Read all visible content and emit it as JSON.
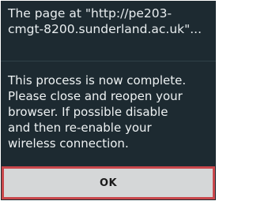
{
  "dialog": {
    "title": "The page at \"http://pe203-\ncmgt-8200.sunderland.ac.uk\"...",
    "message": "This process is now complete.\nPlease close and reopen your\nbrowser. If possible disable\nand then re-enable your\nwireless connection.",
    "ok_label": "OK"
  },
  "colors": {
    "dialog_background": "#1d2a31",
    "button_background": "#d5d7d8",
    "button_focus_border": "#c9474c"
  }
}
